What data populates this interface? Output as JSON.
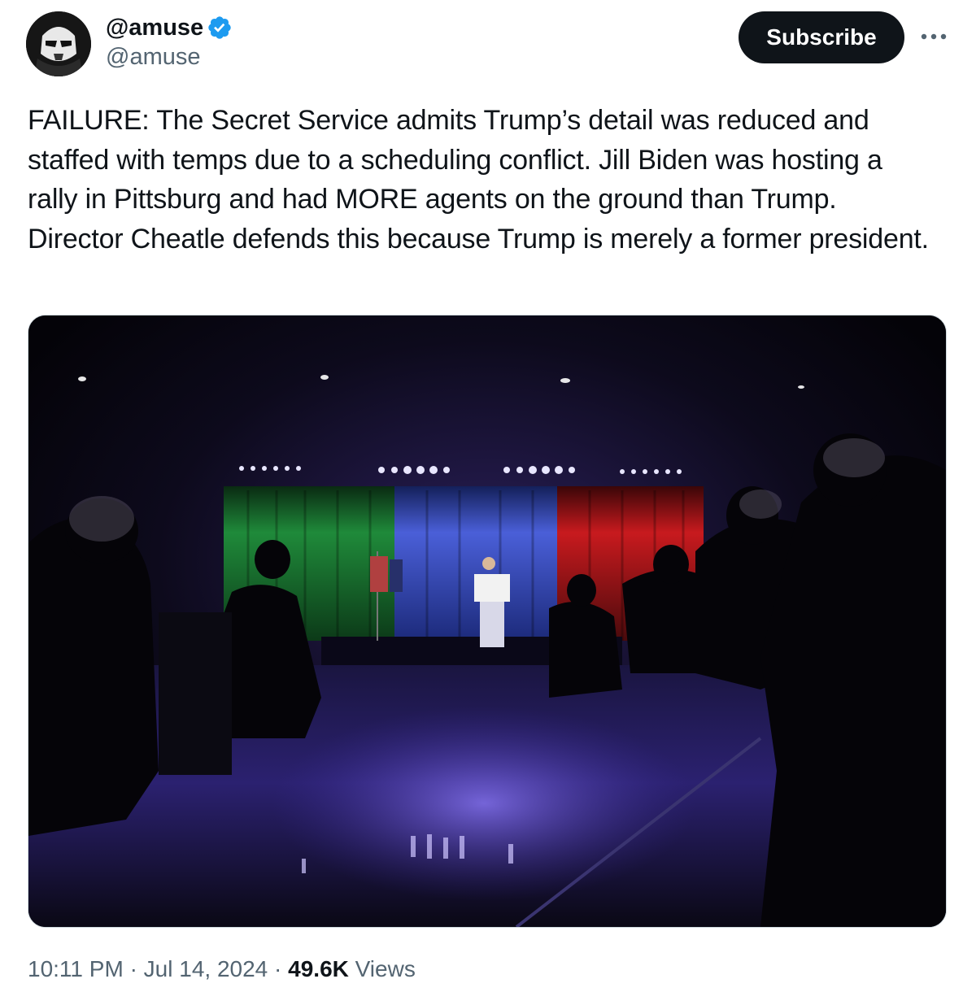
{
  "tweet": {
    "author": {
      "display_name": "@amuse",
      "handle": "@amuse",
      "verified": true,
      "avatar_icon": "stormtrooper-avatar-icon"
    },
    "subscribe_label": "Subscribe",
    "more_icon": "more-options-icon",
    "text": "FAILURE: The Secret Service admits Trump’s detail was reduced and staffed with temps due to a scheduling conflict. Jill Biden was hosting a rally in Pittsburg and had MORE agents on the ground than Trump. Director Cheatle defends this because Trump is merely a former president.",
    "media": {
      "type": "photo",
      "icon": "event-stage-photo"
    },
    "time": "10:11 PM",
    "separator": "·",
    "date": "Jul 14, 2024",
    "views_count": "49.6K",
    "views_label": "Views"
  },
  "colors": {
    "text_primary": "#0f1419",
    "text_secondary": "#536471",
    "verified_blue": "#1d9bf0",
    "button_bg": "#0f1419"
  }
}
